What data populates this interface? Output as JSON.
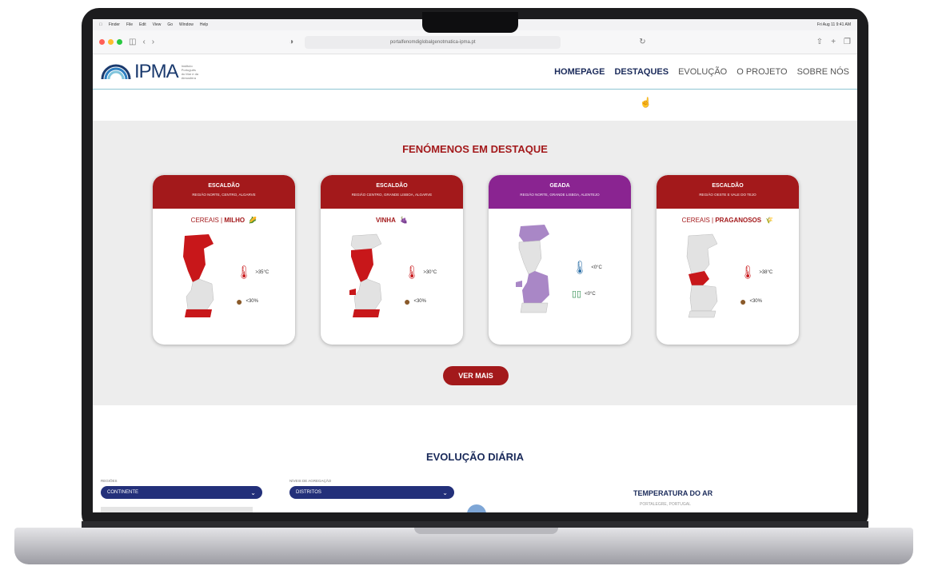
{
  "menubar": {
    "items": [
      "Finder",
      "File",
      "Edit",
      "View",
      "Go",
      "Window",
      "Help"
    ],
    "right": "Fri Aug 11 9:41 AM"
  },
  "browser": {
    "url": "portalfenomdiglobalgenotmatica-ipma.pt",
    "traffic_colors": [
      "#ff5f57",
      "#febc2e",
      "#28c840"
    ]
  },
  "site": {
    "logo": "IPMA",
    "logo_sub": "Instituto Português do Mar e da Atmosfera",
    "nav": [
      "HOMEPAGE",
      "DESTAQUES",
      "EVOLUÇÃO",
      "O PROJETO",
      "SOBRE NÓS"
    ]
  },
  "fenomenos": {
    "title": "FENÓMENOS EM DESTAQUE",
    "cards": [
      {
        "title": "ESCALDÃO",
        "region": "REGIÃO NORTE, CENTRO, ALGARVE",
        "crop": "CEREAIS",
        "crop_detail": "MILHO",
        "temp": ">35°C",
        "humidity": "<30%",
        "color": "#a3191b"
      },
      {
        "title": "ESCALDÃO",
        "region": "REGIÃO CENTRO, GRANDE LISBOA, ALGARVE",
        "crop": "VINHA",
        "crop_detail": "",
        "temp": ">30°C",
        "humidity": "<30%",
        "color": "#a3191b"
      },
      {
        "title": "GEADA",
        "region": "REGIÃO NORTE, GRANDE LISBOA, ALENTEJO",
        "crop": "",
        "crop_detail": "",
        "temp": "<0°C",
        "humidity": "<0°C",
        "color": "#8a2491"
      },
      {
        "title": "ESCALDÃO",
        "region": "REGIÃO OESTE E VALE DO TEJO",
        "crop": "CEREAIS",
        "crop_detail": "PRAGANOSOS",
        "temp": ">38°C",
        "humidity": "<30%",
        "color": "#a3191b"
      }
    ],
    "button": "VER MAIS"
  },
  "evolucao": {
    "title": "EVOLUÇÃO DIÁRIA",
    "regioes_label": "REGIÕES",
    "regioes_value": "CONTINENTE",
    "niveis_label": "NÍVEIS DE AGREGAÇÃO",
    "niveis_value": "DISTRITOS",
    "temp_title": "TEMPERATURA DO AR",
    "temp_sub": "PORTALEGRE, PORTUGAL"
  }
}
